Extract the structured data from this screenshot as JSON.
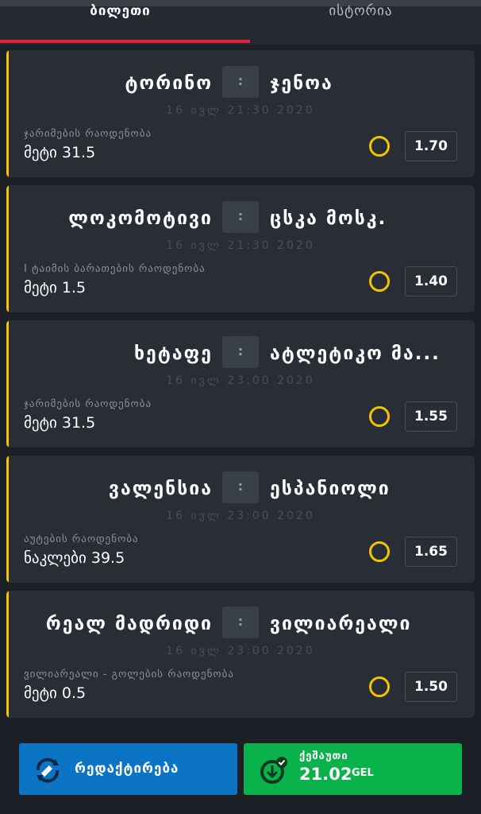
{
  "tabs": [
    {
      "label": "ბილეთი",
      "active": true
    },
    {
      "label": "ისტორია",
      "active": false
    }
  ],
  "bets": [
    {
      "home": "ტორინო",
      "away": "ჯენოა",
      "score_separator": ":",
      "date": "16 ივლ 21:30 2020",
      "market": "ჯარიმების რაოდენობა",
      "selection": "მეტი 31.5",
      "odds": "1.70"
    },
    {
      "home": "ლოკომოტივი",
      "away": "ცსკა მოსკ.",
      "score_separator": ":",
      "date": "16 ივლ 21:30 2020",
      "market": "I ტაიმის ბარათების რაოდენობა",
      "selection": "მეტი 1.5",
      "odds": "1.40"
    },
    {
      "home": "ხეტაფე",
      "away": "ატლეტიკო მა...",
      "score_separator": ":",
      "date": "16 ივლ 23:00 2020",
      "market": "ჯარიმების რაოდენობა",
      "selection": "მეტი 31.5",
      "odds": "1.55"
    },
    {
      "home": "ვალენსია",
      "away": "ესპანიოლი",
      "score_separator": ":",
      "date": "16 ივლ 23:00 2020",
      "market": "აუტების რაოდენობა",
      "selection": "ნაკლები 39.5",
      "odds": "1.65"
    },
    {
      "home": "რეალ მადრიდი",
      "away": "ვილიარეალი",
      "score_separator": ":",
      "date": "16 ივლ 23:00 2020",
      "market": "ვილიარეალი - გოლების რაოდენობა",
      "selection": "მეტი 0.5",
      "odds": "1.50"
    }
  ],
  "footer": {
    "edit_label": "რედაქტირება",
    "cashout_label": "ქეშაუთი",
    "cashout_amount": "21.02",
    "cashout_currency": "GEL"
  },
  "colors": {
    "accent_yellow": "#f5c400",
    "tab_underline": "#e8213a",
    "edit_button": "#0c74c4",
    "cashout_button": "#09b24a"
  },
  "icons": {
    "edit": "refresh-edit-icon",
    "cashout": "cashout-check-icon",
    "pick": "pick-circle-icon"
  }
}
